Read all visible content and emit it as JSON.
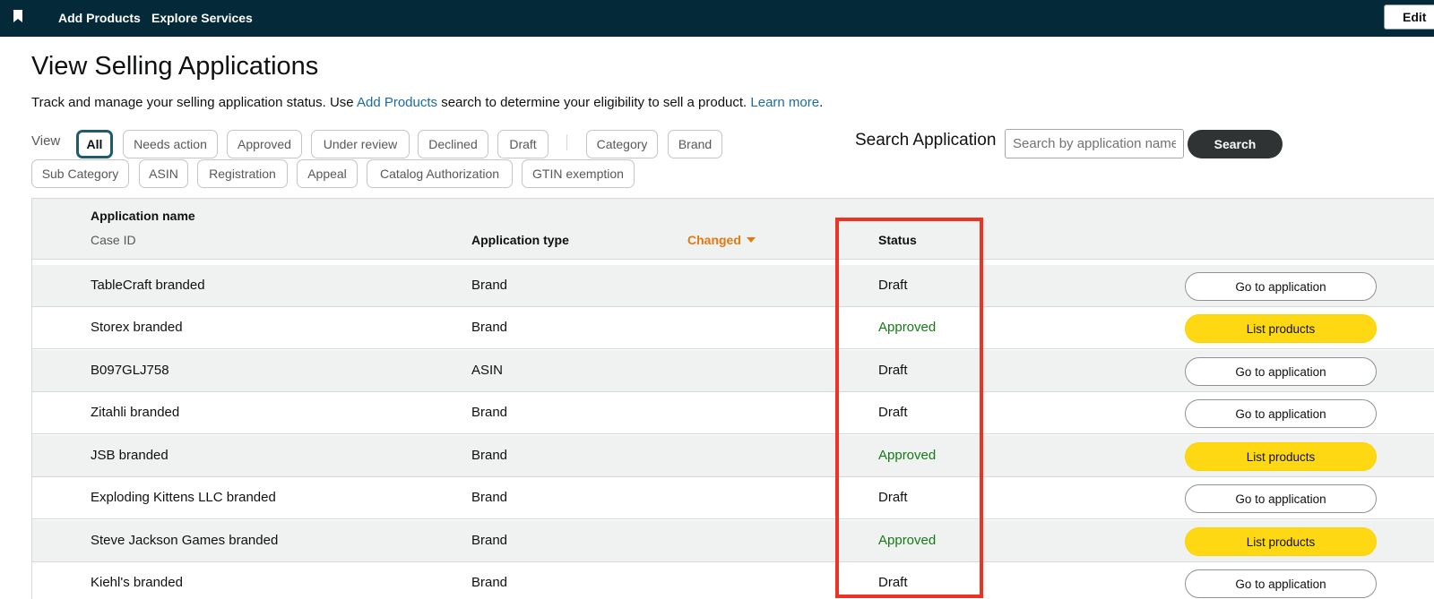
{
  "topbar": {
    "bookmark_icon": "bookmark-icon",
    "links": [
      "Add Products",
      "Explore Services"
    ],
    "edit_label": "Edit"
  },
  "page": {
    "title": "View Selling Applications",
    "intro_before": "Track and manage your selling application status. Use ",
    "intro_link": "Add Products",
    "intro_middle": " search to determine your eligibility to sell a product. ",
    "intro_learn_more": "Learn more",
    "intro_end": "."
  },
  "filters": {
    "view_label": "View",
    "row1": [
      "All",
      "Needs action",
      "Approved",
      "Under review",
      "Declined",
      "Draft",
      "Category",
      "Brand"
    ],
    "row2": [
      "Sub Category",
      "ASIN",
      "Registration",
      "Appeal",
      "Catalog Authorization",
      "GTIN exemption"
    ],
    "active": "All"
  },
  "search": {
    "label": "Search Application",
    "placeholder": "Search by application name",
    "value": "",
    "button_label": "Search"
  },
  "table": {
    "headers": {
      "name": "Application name",
      "case_id": "Case ID",
      "type": "Application type",
      "changed": "Changed",
      "status": "Status"
    },
    "sorted_by": "Changed",
    "rows": [
      {
        "name": "TableCraft branded",
        "type": "Brand",
        "status": "Draft",
        "action": "Go to application"
      },
      {
        "name": "Storex branded",
        "type": "Brand",
        "status": "Approved",
        "action": "List products"
      },
      {
        "name": "B097GLJ758",
        "type": "ASIN",
        "status": "Draft",
        "action": "Go to application"
      },
      {
        "name": "Zitahli branded",
        "type": "Brand",
        "status": "Draft",
        "action": "Go to application"
      },
      {
        "name": "JSB branded",
        "type": "Brand",
        "status": "Approved",
        "action": "List products"
      },
      {
        "name": "Exploding Kittens LLC branded",
        "type": "Brand",
        "status": "Draft",
        "action": "Go to application"
      },
      {
        "name": "Steve Jackson Games branded",
        "type": "Brand",
        "status": "Approved",
        "action": "List products"
      },
      {
        "name": "Kiehl's branded",
        "type": "Brand",
        "status": "Draft",
        "action": "Go to application"
      }
    ]
  },
  "colors": {
    "topbar": "#042a3a",
    "link": "#1a6ba1",
    "sort_accent": "#e47911",
    "approved": "#157a15",
    "primary_button": "#ffd814",
    "highlight": "#ee3324"
  }
}
